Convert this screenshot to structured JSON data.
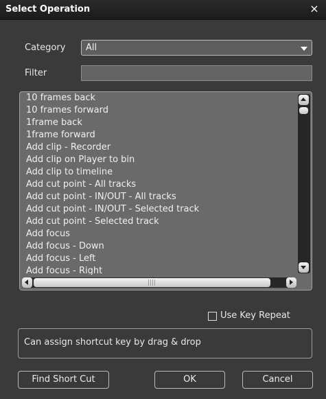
{
  "window": {
    "title": "Select Operation",
    "close_glyph": "×"
  },
  "category": {
    "label": "Category",
    "value": "All"
  },
  "filter": {
    "label": "Filter",
    "value": ""
  },
  "operations": [
    "10 frames back",
    "10 frames forward",
    "1frame back",
    "1frame forward",
    "Add clip - Recorder",
    "Add clip on Player to bin",
    "Add clip to timeline",
    "Add cut point - All tracks",
    "Add cut point - IN/OUT - All tracks",
    "Add cut point - IN/OUT - Selected track",
    "Add cut point - Selected track",
    "Add focus",
    "Add focus - Down",
    "Add focus - Left",
    "Add focus - Right"
  ],
  "use_key_repeat": {
    "label": "Use Key Repeat",
    "checked": false
  },
  "hint": "Can assign shortcut key by drag & drop",
  "buttons": {
    "find": "Find Short Cut",
    "ok": "OK",
    "cancel": "Cancel"
  }
}
